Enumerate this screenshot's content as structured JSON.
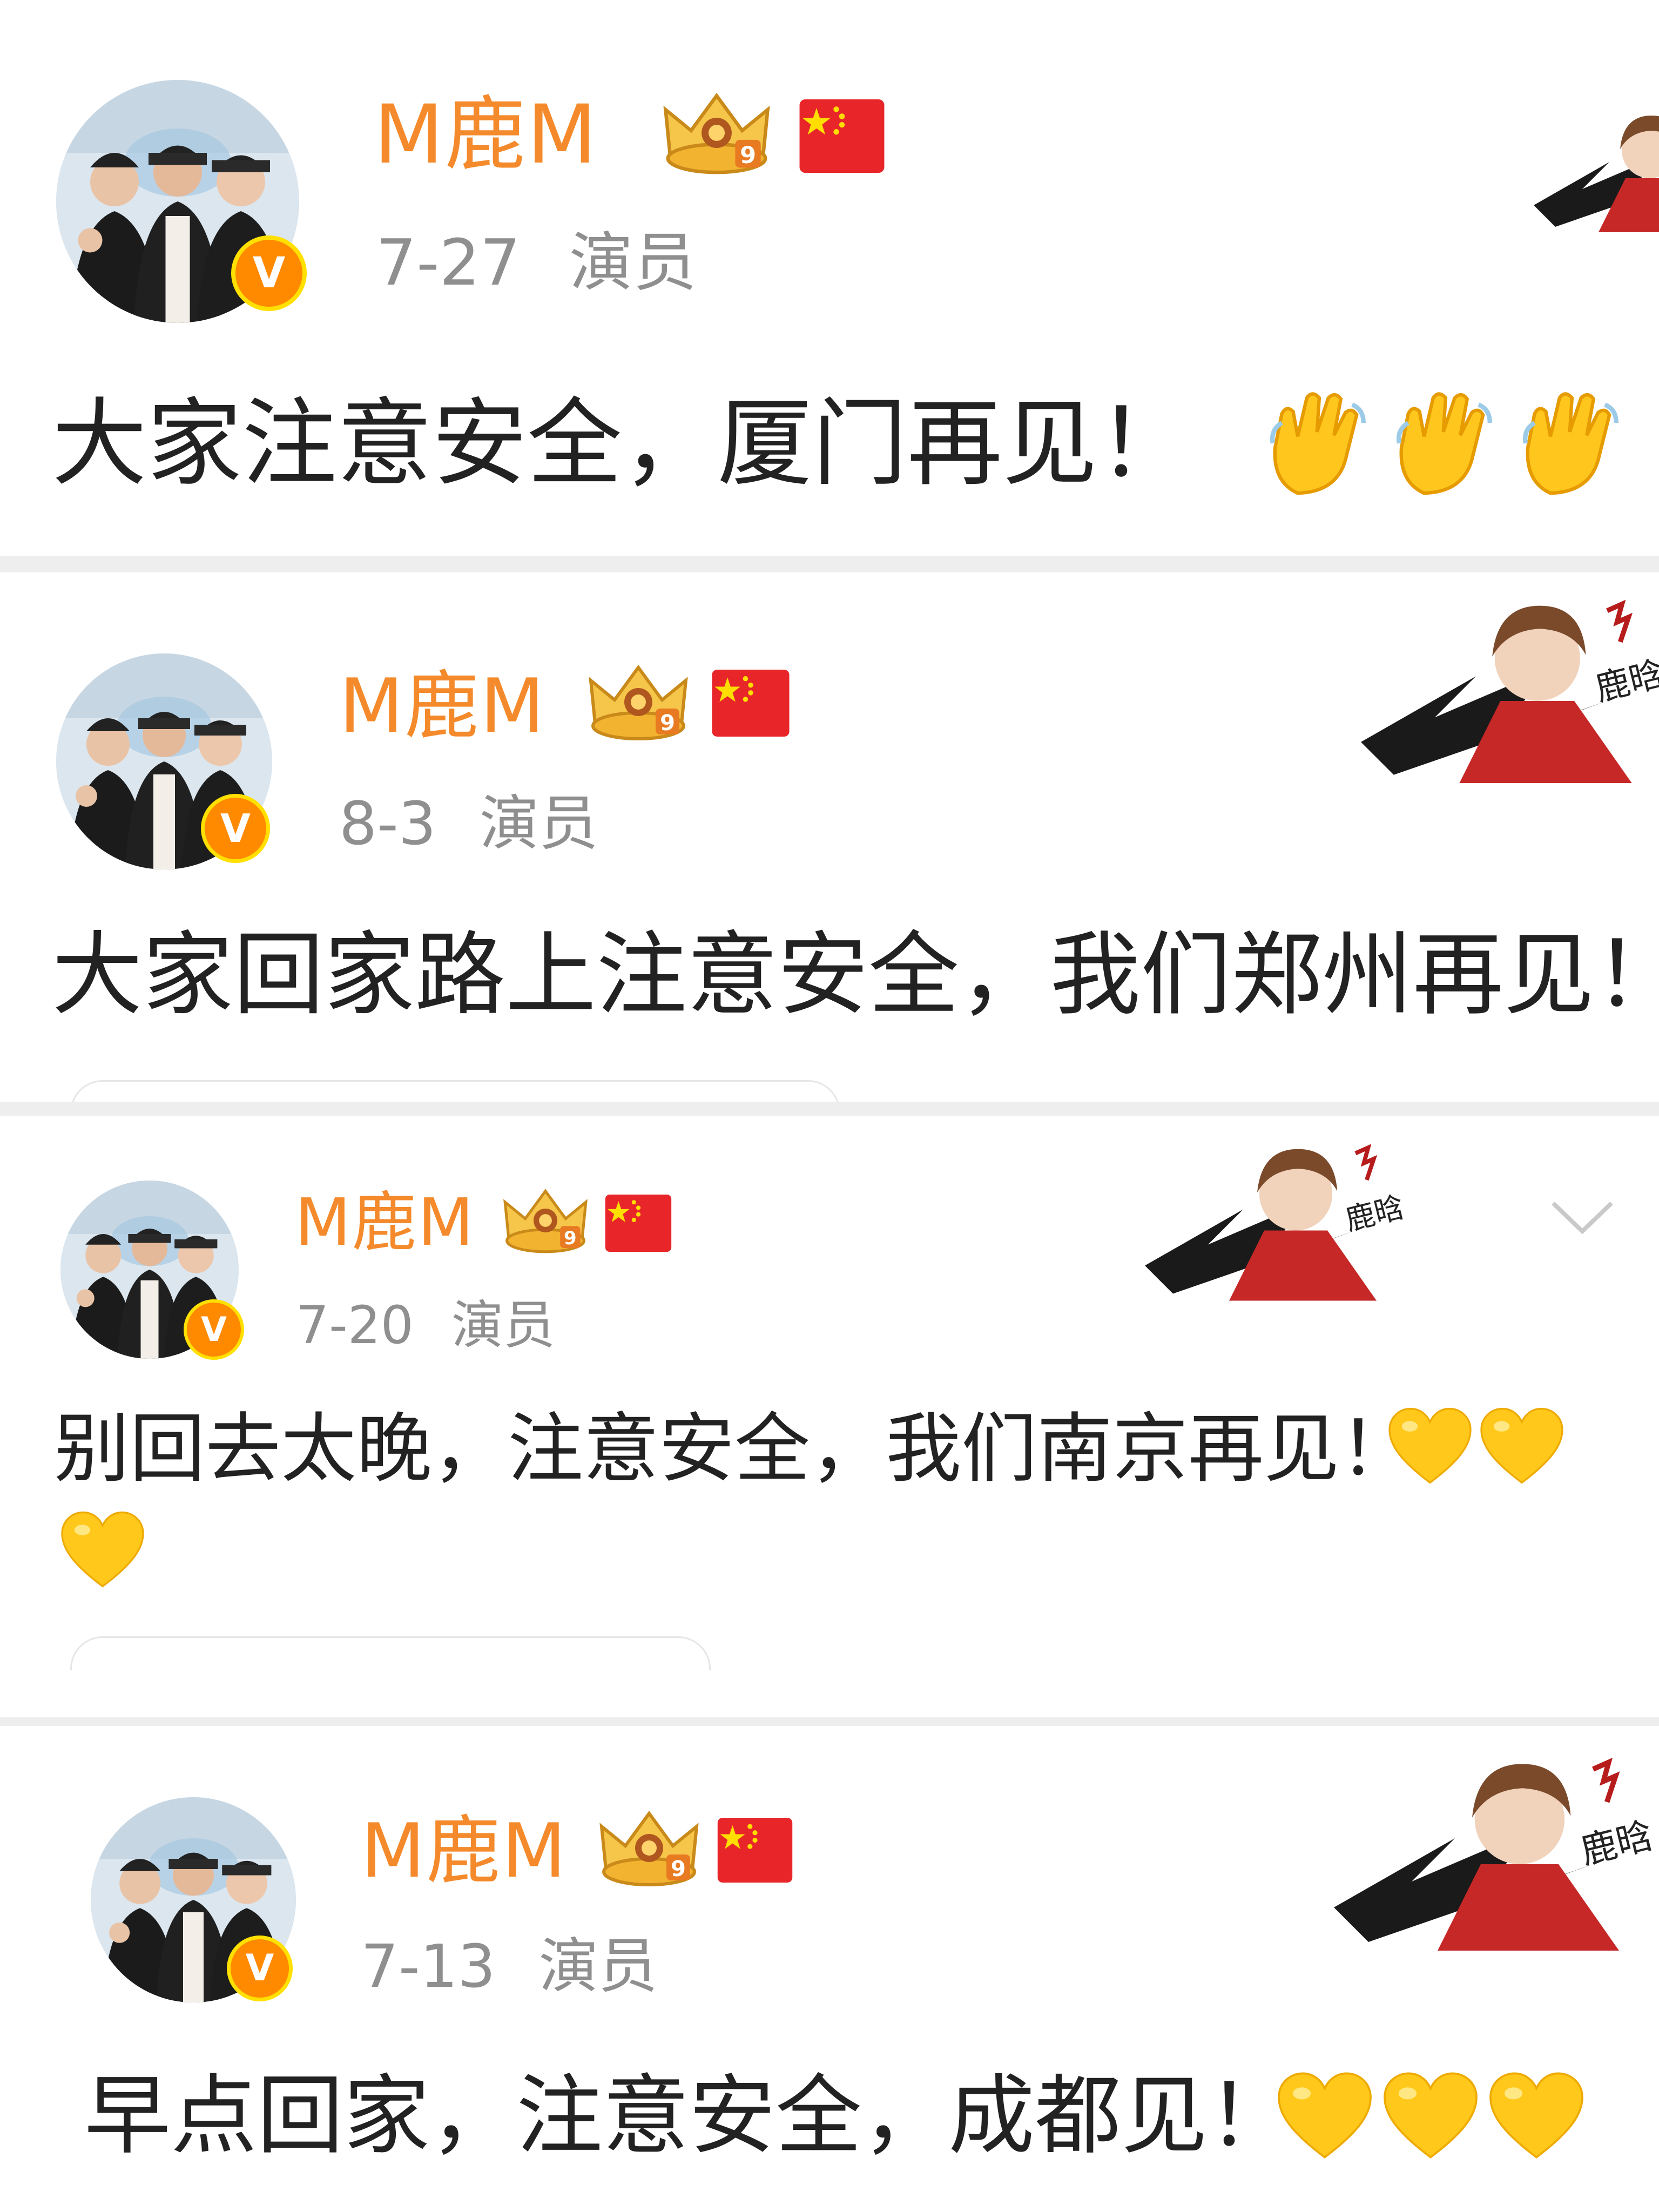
{
  "posts": [
    {
      "username": "M鹿M",
      "date": "7-27",
      "source": "演员",
      "text": "大家注意安全，厦门再见！",
      "emoji": "clapping-hands",
      "emoji_count": 3
    },
    {
      "username": "M鹿M",
      "date": "8-3",
      "source": "演员",
      "text": "大家回家路上注意安全，我们郑州再见！",
      "emoji": "",
      "emoji_count": 0
    },
    {
      "username": "M鹿M",
      "date": "7-20",
      "source": "演员",
      "text": "别回去太晚，注意安全，我们南京再见！",
      "emoji": "yellow-heart",
      "emoji_count": 3
    },
    {
      "username": "M鹿M",
      "date": "7-13",
      "source": "演员",
      "text": "早点回家，注意安全，成都见！",
      "emoji": "yellow-heart",
      "emoji_count": 3
    }
  ],
  "badges": {
    "crown_level": "9",
    "verified_letter": "V",
    "flag": "china-flag"
  },
  "colors": {
    "username": "#f48a2b",
    "meta": "#8f8f8f",
    "text": "#222222",
    "verified": "#ff8a00",
    "heart": "#ffc81a",
    "separator": "#eeeeee"
  }
}
